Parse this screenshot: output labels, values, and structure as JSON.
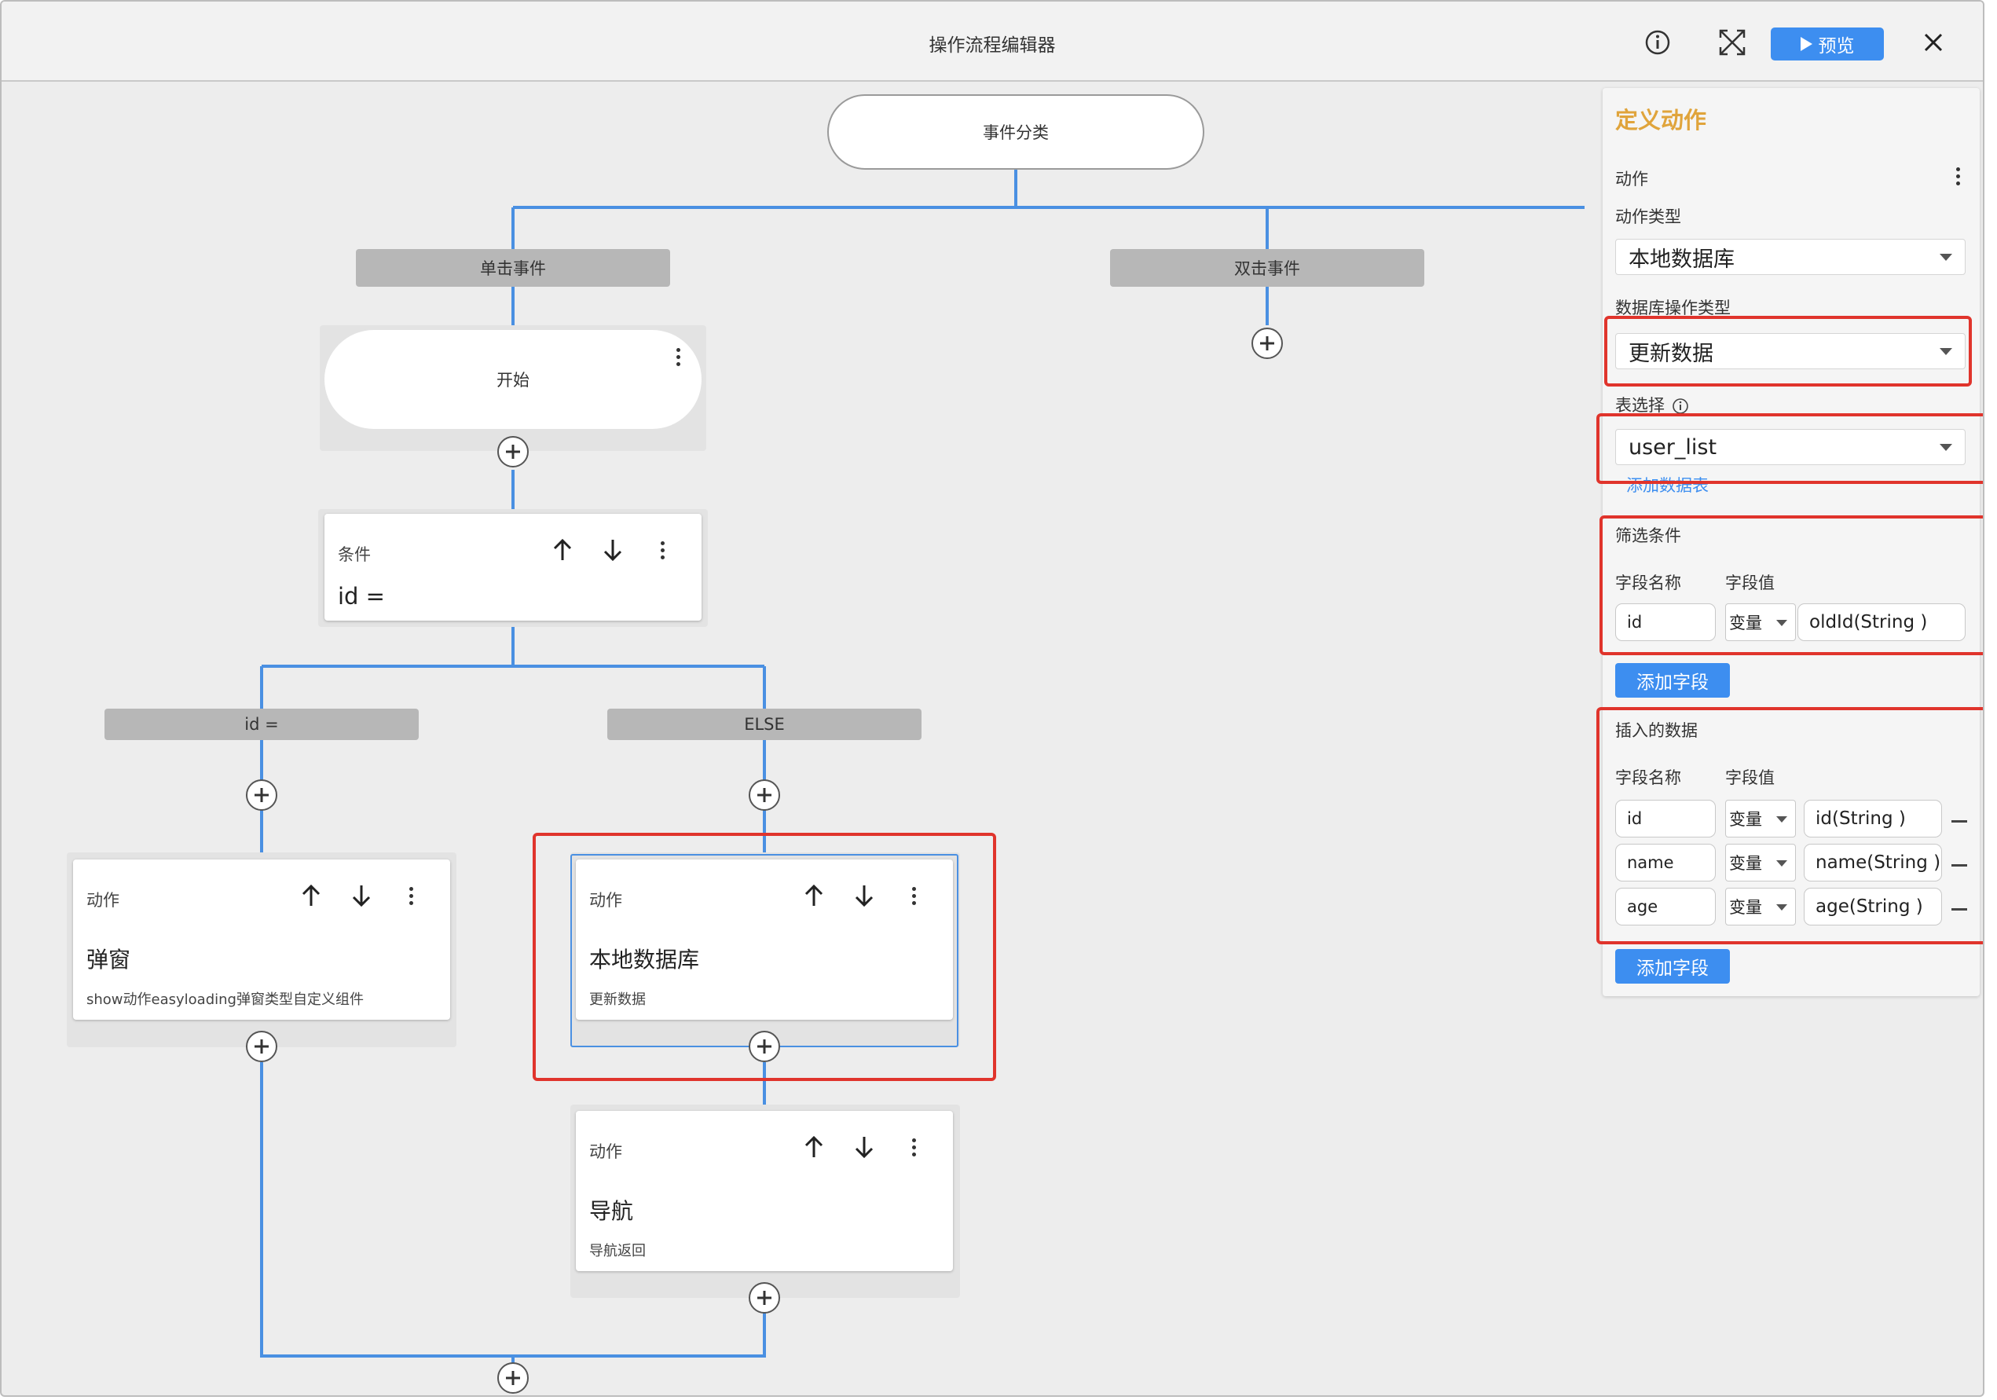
{
  "header": {
    "title": "操作流程编辑器",
    "preview_label": "预览",
    "icons": [
      "info-icon",
      "expand-icon",
      "play-icon",
      "close-icon"
    ]
  },
  "flow": {
    "root": "事件分类",
    "branches": {
      "click": "单击事件",
      "double_click": "双击事件",
      "condition_true": "id =",
      "condition_else": "ELSE"
    },
    "start": "开始",
    "condition": {
      "label": "条件",
      "value": "id ="
    },
    "cards": {
      "popup": {
        "label": "动作",
        "title": "弹窗",
        "desc": "show动作easyloading弹窗类型自定义组件"
      },
      "db": {
        "label": "动作",
        "title": "本地数据库",
        "desc": "更新数据"
      },
      "nav": {
        "label": "动作",
        "title": "导航",
        "desc": "导航返回"
      }
    }
  },
  "panel": {
    "title": "定义动作",
    "action_label": "动作",
    "action_type_label": "动作类型",
    "action_type_value": "本地数据库",
    "db_op_label": "数据库操作类型",
    "db_op_value": "更新数据",
    "table_label": "表选择",
    "table_value": "user_list",
    "add_table_link": "添加数据表",
    "filter": {
      "title": "筛选条件",
      "col_name": "字段名称",
      "col_value": "字段值",
      "rows": [
        {
          "name": "id",
          "type": "变量",
          "value": "oldId(String )"
        }
      ]
    },
    "add_field_label": "添加字段",
    "insert": {
      "title": "插入的数据",
      "col_name": "字段名称",
      "col_value": "字段值",
      "rows": [
        {
          "name": "id",
          "type": "变量",
          "value": "id(String )"
        },
        {
          "name": "name",
          "type": "变量",
          "value": "name(String )"
        },
        {
          "name": "age",
          "type": "变量",
          "value": "age(String )"
        }
      ]
    }
  },
  "colors": {
    "accent": "#3d8ef0",
    "line": "#4a90e2",
    "highlight": "#e0342c",
    "panel_title": "#e0a43b"
  }
}
